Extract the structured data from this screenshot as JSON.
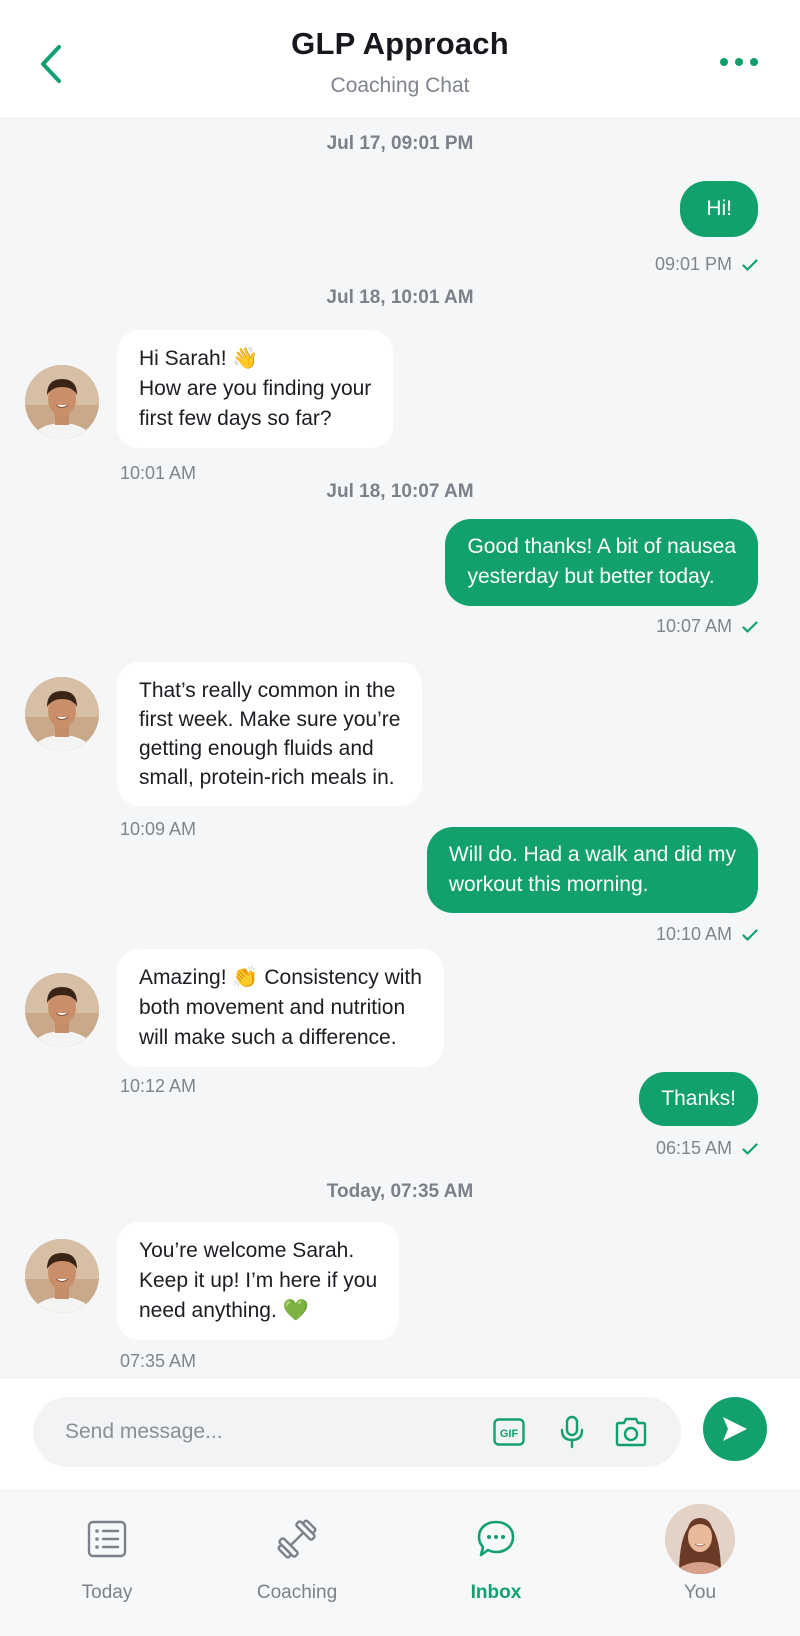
{
  "header": {
    "title": "GLP Approach",
    "subtitle": "Coaching Chat"
  },
  "chat": {
    "date_1": "Jul 17, 09:01 PM",
    "m1": {
      "lines": [
        "Hi!"
      ],
      "time": "09:01 PM"
    },
    "date_2": "Jul 18, 10:01 AM",
    "m2": {
      "lines": [
        "Hi Sarah! 👋",
        "How are you finding your",
        "first few days so far?"
      ],
      "time": "10:01 AM"
    },
    "date_3": "Jul 18, 10:07 AM",
    "m3": {
      "lines": [
        "Good thanks! A bit of nausea",
        "yesterday but better today."
      ],
      "time": "10:07 AM"
    },
    "m4": {
      "lines": [
        "That’s really common in the",
        "first week. Make sure you’re",
        "getting enough fluids and",
        "small, protein-rich meals in."
      ],
      "time": "10:09 AM"
    },
    "m5": {
      "lines": [
        "Will do. Had a walk and did my",
        "workout this morning."
      ],
      "time": "10:10 AM"
    },
    "m6": {
      "lines": [
        "Amazing! 👏 Consistency with",
        "both movement and nutrition",
        "will make such a difference."
      ],
      "time": "10:12 AM"
    },
    "m7": {
      "lines": [
        "Thanks!"
      ],
      "time": "06:15 AM"
    },
    "date_4": "Today, 07:35 AM",
    "m8": {
      "lines": [
        "You’re welcome Sarah.",
        "Keep it up! I’m here if you",
        "need anything. 💚"
      ],
      "time": "07:35 AM"
    }
  },
  "composer": {
    "placeholder": "Send message...",
    "gif_label": "GIF"
  },
  "tabs": {
    "today": "Today",
    "coaching": "Coaching",
    "inbox": "Inbox",
    "you": "You"
  },
  "colors": {
    "accent": "#12a06c",
    "background": "#f5f6f7",
    "muted_text": "#7f858d"
  },
  "icons": {
    "back": "chevron-left-icon",
    "more": "more-dots-icon",
    "read_receipt": "check-icon",
    "gif": "gif-icon",
    "mic": "microphone-icon",
    "camera": "camera-icon",
    "send": "send-icon",
    "today": "list-icon",
    "coaching": "dumbbell-icon",
    "inbox": "chat-bubble-icon"
  }
}
